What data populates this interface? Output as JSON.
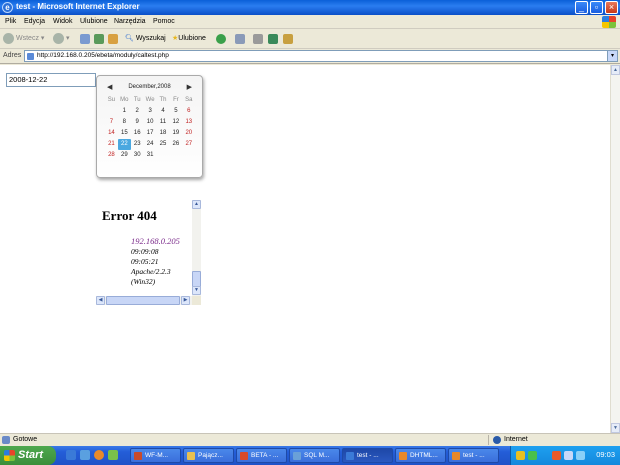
{
  "window": {
    "title": "test - Microsoft Internet Explorer"
  },
  "menu": [
    "Plik",
    "Edycja",
    "Widok",
    "Ulubione",
    "Narzędzia",
    "Pomoc"
  ],
  "toolbar": {
    "back_label": "Wstecz",
    "search_label": "Wyszukaj",
    "favorites_label": "Ulubione"
  },
  "address": {
    "label": "Adres",
    "url": "http://192.168.0.205/ebeta/moduly/caltest.php"
  },
  "page": {
    "date_value": "2008-12-22",
    "calendar": {
      "month_label": "December,2008",
      "weekdays": [
        "Su",
        "Mo",
        "Tu",
        "We",
        "Th",
        "Fr",
        "Sa"
      ],
      "weeks": [
        [
          "",
          "1",
          "2",
          "3",
          "4",
          "5",
          "6"
        ],
        [
          "7",
          "8",
          "9",
          "10",
          "11",
          "12",
          "13"
        ],
        [
          "14",
          "15",
          "16",
          "17",
          "18",
          "19",
          "20"
        ],
        [
          "21",
          "22",
          "23",
          "24",
          "25",
          "26",
          "27"
        ],
        [
          "28",
          "29",
          "30",
          "31",
          "",
          "",
          ""
        ]
      ],
      "selected_day": "22"
    },
    "error": {
      "title": "Error 404",
      "host": "192.168.0.205",
      "time1": "09:09:08",
      "time2": "09:05:21",
      "server1": "Apache/2.2.3",
      "server2": "(Win32)"
    }
  },
  "status": {
    "text": "Gotowe",
    "zone": "Internet"
  },
  "taskbar": {
    "start_label": "Start",
    "tasks": [
      "WF-M...",
      "Pającz...",
      "BETA - ...",
      "SQL M...",
      "test - ...",
      "DHTML...",
      "test - ..."
    ],
    "clock": "09:03"
  }
}
